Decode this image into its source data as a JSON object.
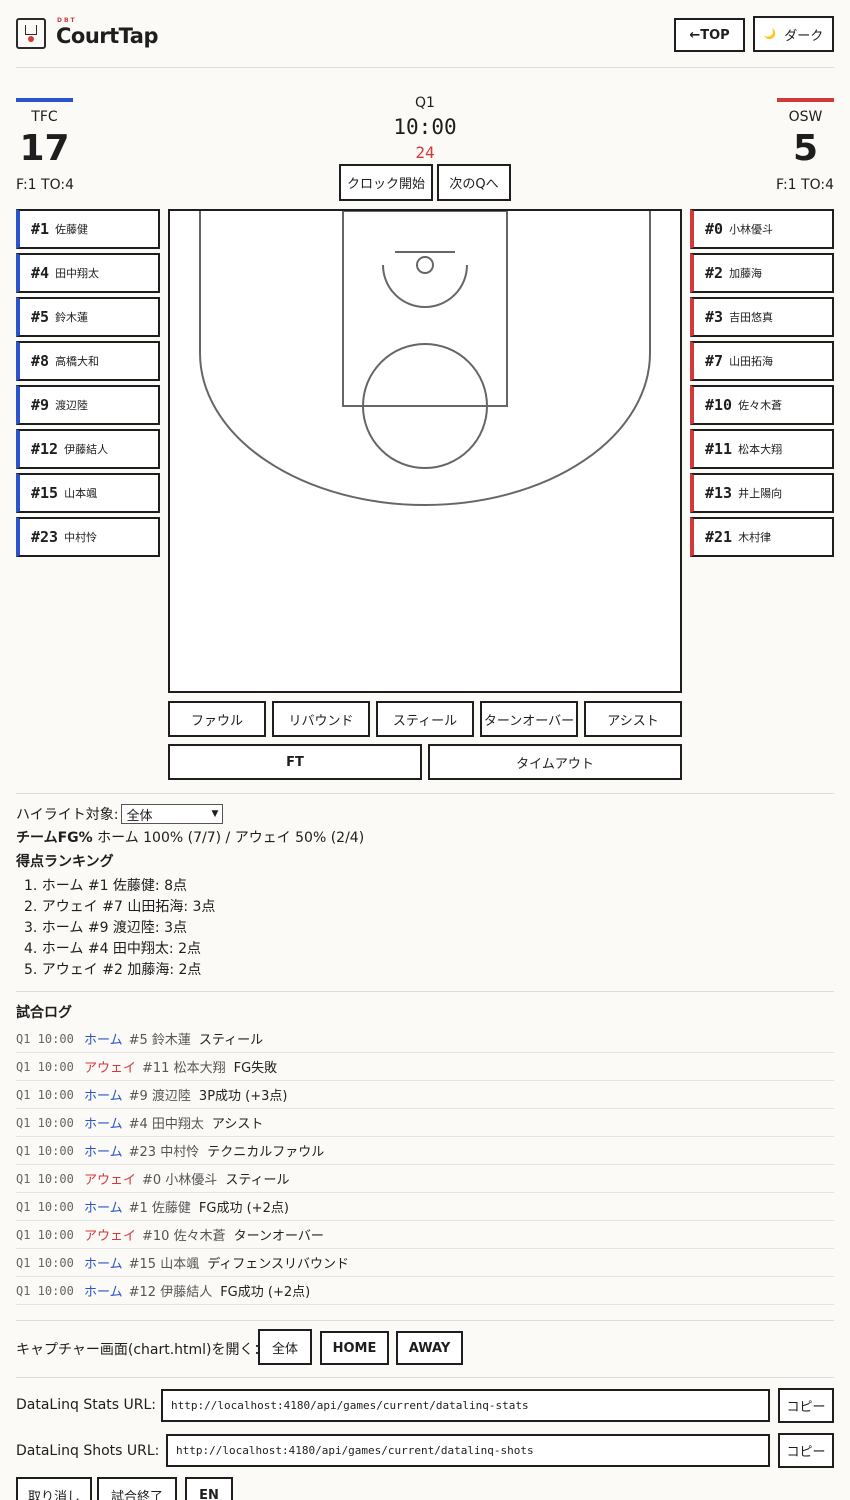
{
  "header": {
    "brand_small": "DBT",
    "brand": "CourtTap",
    "top_button": "←TOP",
    "dark_icon": "🌙",
    "dark_button": "ダーク"
  },
  "scoreboard": {
    "quarter": "Q1",
    "game_clock": "10:00",
    "shot_clock": "24",
    "start_clock_button": "クロック開始",
    "next_quarter_button": "次のQへ",
    "home": {
      "name": "TFC",
      "score": "17",
      "meta": "F:1 TO:4",
      "color": "#2a54c9"
    },
    "away": {
      "name": "OSW",
      "score": "5",
      "meta": "F:1 TO:4",
      "color": "#d23a3a"
    }
  },
  "home_roster": [
    {
      "num": "#1",
      "name": "佐藤健"
    },
    {
      "num": "#4",
      "name": "田中翔太"
    },
    {
      "num": "#5",
      "name": "鈴木蓮"
    },
    {
      "num": "#8",
      "name": "高橋大和"
    },
    {
      "num": "#9",
      "name": "渡辺陸"
    },
    {
      "num": "#12",
      "name": "伊藤結人"
    },
    {
      "num": "#15",
      "name": "山本颯"
    },
    {
      "num": "#23",
      "name": "中村怜"
    }
  ],
  "away_roster": [
    {
      "num": "#0",
      "name": "小林優斗"
    },
    {
      "num": "#2",
      "name": "加藤海"
    },
    {
      "num": "#3",
      "name": "吉田悠真"
    },
    {
      "num": "#7",
      "name": "山田拓海"
    },
    {
      "num": "#10",
      "name": "佐々木蒼"
    },
    {
      "num": "#11",
      "name": "松本大翔"
    },
    {
      "num": "#13",
      "name": "井上陽向"
    },
    {
      "num": "#21",
      "name": "木村律"
    }
  ],
  "actions": {
    "foul": "ファウル",
    "rebound": "リバウンド",
    "steal": "スティール",
    "turnover": "ターンオーバー",
    "assist": "アシスト",
    "ft": "FT",
    "timeout": "タイムアウト"
  },
  "stats": {
    "highlight_label": "ハイライト対象:",
    "highlight_value": "全体",
    "fg_label": "チームFG%",
    "fg_value": " ホーム 100% (7/7) / アウェイ 50% (2/4)",
    "ranking_title": "得点ランキング",
    "ranking": [
      "1. ホーム #1 佐藤健: 8点",
      "2. アウェイ #7 山田拓海: 3点",
      "3. ホーム #9 渡辺陸: 3点",
      "4. ホーム #4 田中翔太: 2点",
      "5. アウェイ #2 加藤海: 2点"
    ]
  },
  "log": {
    "title": "試合ログ",
    "rows": [
      {
        "time": "Q1 10:00",
        "team": "ホーム",
        "side": "home",
        "player": "#5 鈴木蓮",
        "action": "スティール"
      },
      {
        "time": "Q1 10:00",
        "team": "アウェイ",
        "side": "away",
        "player": "#11 松本大翔",
        "action": "FG失敗"
      },
      {
        "time": "Q1 10:00",
        "team": "ホーム",
        "side": "home",
        "player": "#9 渡辺陸",
        "action": "3P成功 (+3点)"
      },
      {
        "time": "Q1 10:00",
        "team": "ホーム",
        "side": "home",
        "player": "#4 田中翔太",
        "action": "アシスト"
      },
      {
        "time": "Q1 10:00",
        "team": "ホーム",
        "side": "home",
        "player": "#23 中村怜",
        "action": "テクニカルファウル"
      },
      {
        "time": "Q1 10:00",
        "team": "アウェイ",
        "side": "away",
        "player": "#0 小林優斗",
        "action": "スティール"
      },
      {
        "time": "Q1 10:00",
        "team": "ホーム",
        "side": "home",
        "player": "#1 佐藤健",
        "action": "FG成功 (+2点)"
      },
      {
        "time": "Q1 10:00",
        "team": "アウェイ",
        "side": "away",
        "player": "#10 佐々木蒼",
        "action": "ターンオーバー"
      },
      {
        "time": "Q1 10:00",
        "team": "ホーム",
        "side": "home",
        "player": "#15 山本颯",
        "action": "ディフェンスリバウンド"
      },
      {
        "time": "Q1 10:00",
        "team": "ホーム",
        "side": "home",
        "player": "#12 伊藤結人",
        "action": "FG成功 (+2点)"
      }
    ]
  },
  "capture": {
    "label": "キャプチャー画面(chart.html)を開く：",
    "all": "全体",
    "home": "HOME",
    "away": "AWAY"
  },
  "datalinq": {
    "stats_label": "DataLinq Stats URL:",
    "stats_url": "http://localhost:4180/api/games/current/datalinq-stats",
    "shots_label": "DataLinq Shots URL:",
    "shots_url": "http://localhost:4180/api/games/current/datalinq-shots",
    "copy": "コピー"
  },
  "footer": {
    "undo": "取り消し",
    "end_game": "試合終了",
    "lang": "EN"
  }
}
